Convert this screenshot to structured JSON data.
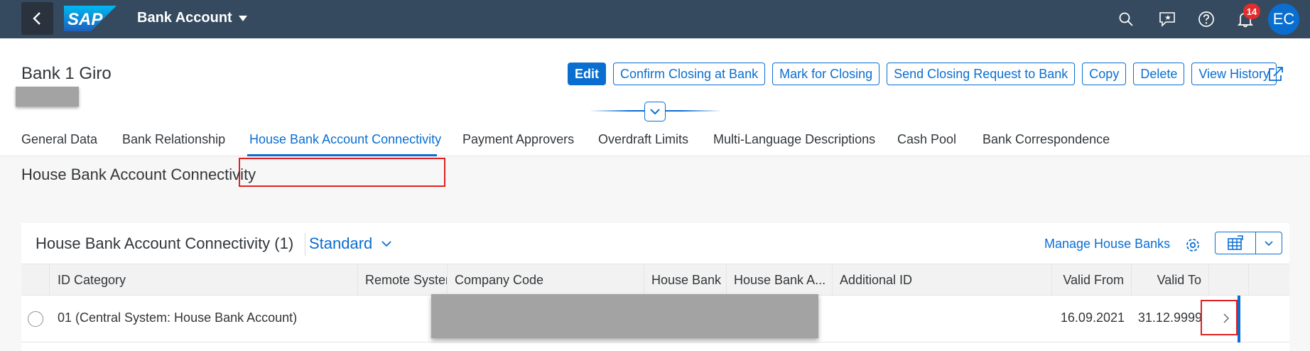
{
  "shell": {
    "app_title": "Bank Account",
    "logo_text": "SAP",
    "notification_count": "14",
    "user_initials": "EC",
    "icons": [
      "back-icon",
      "search-icon",
      "feedback-icon",
      "help-icon",
      "bell-icon"
    ]
  },
  "header": {
    "title": "Bank 1 Giro",
    "actions": {
      "edit": "Edit",
      "confirm_closing": "Confirm Closing at Bank",
      "mark_for_closing": "Mark for Closing",
      "send_closing_request": "Send Closing Request to Bank",
      "copy": "Copy",
      "delete": "Delete",
      "view_history": "View History"
    }
  },
  "tabs": [
    {
      "label": "General Data"
    },
    {
      "label": "Bank Relationship"
    },
    {
      "label": "House Bank Account Connectivity",
      "active": true
    },
    {
      "label": "Payment Approvers"
    },
    {
      "label": "Overdraft Limits"
    },
    {
      "label": "Multi-Language Descriptions"
    },
    {
      "label": "Cash Pool"
    },
    {
      "label": "Bank Correspondence"
    }
  ],
  "section": {
    "title": "House Bank Account Connectivity"
  },
  "table": {
    "title": "House Bank Account Connectivity (1)",
    "variant": "Standard",
    "manage_link": "Manage House Banks",
    "columns": [
      "ID Category",
      "Remote System",
      "Company Code",
      "House Bank",
      "House Bank A...",
      "Additional ID",
      "Valid From",
      "Valid To"
    ],
    "rows": [
      {
        "id_category": "01 (Central System: House Bank Account)",
        "valid_from": "16.09.2021",
        "valid_to": "31.12.9999"
      }
    ]
  },
  "colors": {
    "shell_bg": "#354a5f",
    "accent": "#0a6ed1",
    "highlight": "#e02020",
    "badge": "#e22d2d"
  }
}
